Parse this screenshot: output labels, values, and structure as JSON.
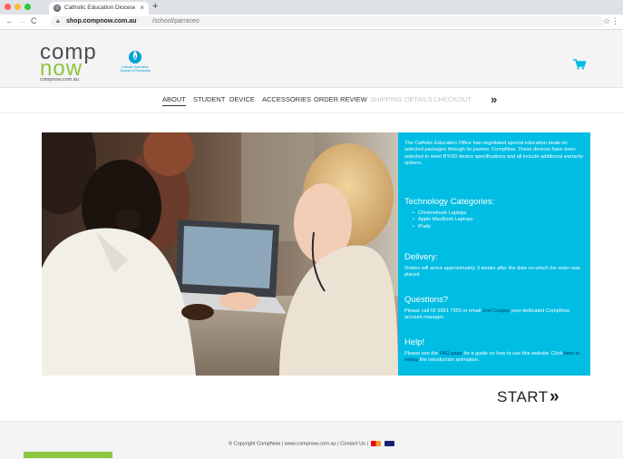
{
  "browser": {
    "tab_title": "Catholic Education Diocese of",
    "tab_close": "×",
    "new_tab": "+",
    "url_host": "shop.compnow.com.au",
    "url_path": "/school/parraceo",
    "dots": [
      "#ff5f57",
      "#febc2e",
      "#28c840"
    ],
    "icons": [
      "back-icon",
      "forward-icon",
      "reload-icon",
      "lock-icon",
      "star-icon",
      "kebab-menu-icon"
    ]
  },
  "header": {
    "logo_line1": "comp",
    "logo_line2": "now",
    "logo_domain": "compnow.com.au",
    "ceo_name": "Catholic Education",
    "ceo_sub": "Diocese of Parramatta",
    "accent": "#8dc63f",
    "cart_color": "#00bde3"
  },
  "nav": {
    "items": [
      {
        "label": "ABOUT",
        "state": "active"
      },
      {
        "label": "STUDENT",
        "state": "enabled"
      },
      {
        "label": "DEVICE",
        "state": "enabled"
      },
      {
        "label": "ACCESSORIES",
        "state": "enabled"
      },
      {
        "label": "ORDER REVIEW",
        "state": "enabled"
      },
      {
        "label": "SHIPPING DETAILS",
        "state": "disabled"
      },
      {
        "label": "CHECKOUT",
        "state": "disabled"
      }
    ],
    "next": "»"
  },
  "info": {
    "intro": "The Catholic Education Office has negotiated special education deals on selected packages through its partner, CompNow. These devices have been selected to meet BYOD device specifications and all include additional warranty options.",
    "tech_heading": "Technology Categories:",
    "tech_items": [
      "Chromebook Laptops",
      "Apple MacBook Laptops",
      "iPads"
    ],
    "delivery_heading": "Delivery:",
    "delivery_text": "Orders will arrive approximately 3 weeks after the date on which the order was placed.",
    "questions_heading": "Questions?",
    "questions_pre": "Please call 02 9951 7955 or email",
    "questions_link": "Joel Cooper",
    "questions_post": "your dedicated CompNow account manager.",
    "help_heading": "Help!",
    "help_pre": "Please see the",
    "help_link1": "FAQ page",
    "help_mid": "for a guide on how to use this website. Click",
    "help_link2": "here to replay",
    "help_post": "the introduction animation.",
    "bg": "#00bde3"
  },
  "start": {
    "label": "START",
    "arrow": "»"
  },
  "footer": {
    "text": "© Copyright CompNow | www.compnow.com.au | Contact Us |"
  }
}
